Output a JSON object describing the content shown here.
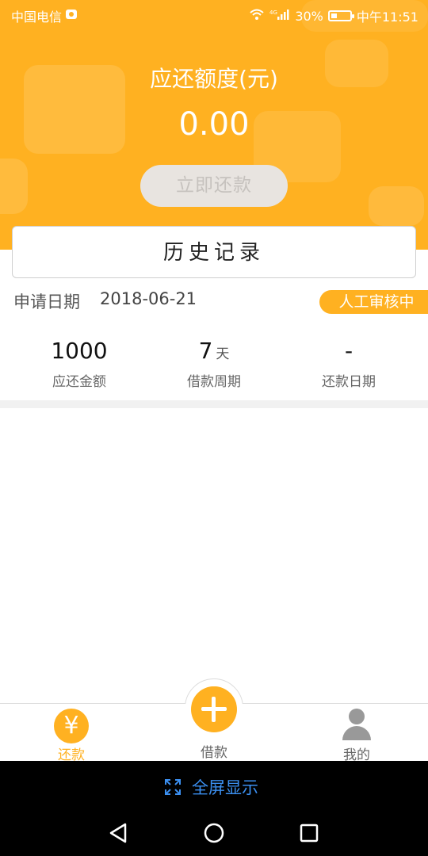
{
  "status_bar": {
    "carrier": "中国电信",
    "battery_percent": "30%",
    "battery_level": 0.3,
    "time": "中午11:51",
    "signal_label": "4G"
  },
  "header": {
    "amount_title": "应还额度(元)",
    "amount_value": "0.00",
    "repay_button": "立即还款",
    "background_color": "#ffb121"
  },
  "history": {
    "title": "历史记录"
  },
  "record": {
    "apply_label": "申请日期",
    "apply_date": "2018-06-21",
    "status": "人工审核中",
    "amount_value": "1000",
    "amount_label": "应还金额",
    "period_value": "7",
    "period_unit": "天",
    "period_label": "借款周期",
    "repay_date_value": "-",
    "repay_date_label": "还款日期"
  },
  "tabbar": {
    "tabs": [
      {
        "label": "还款",
        "icon": "yen-icon",
        "active": true
      },
      {
        "label": "借款",
        "icon": "plus-icon",
        "active": false
      },
      {
        "label": "我的",
        "icon": "person-icon",
        "active": false
      }
    ],
    "active_color": "#ffb121",
    "inactive_color": "#666666"
  },
  "system": {
    "fullscreen_label": "全屏显示"
  }
}
